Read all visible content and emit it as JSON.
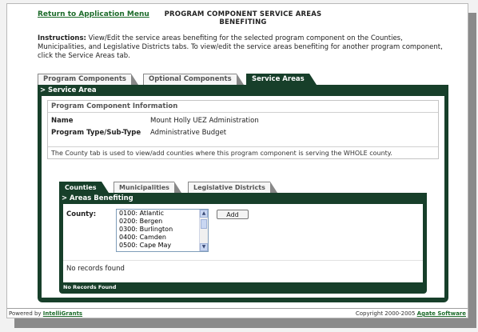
{
  "header": {
    "menu_link": "Return to Application Menu",
    "title_line1": "PROGRAM COMPONENT SERVICE AREAS",
    "title_line2": "BENEFITING"
  },
  "instructions": {
    "label": "Instructions:",
    "text": " View/Edit the service areas benefiting for the selected program component on the Counties, Municipalities, and Legislative Districts tabs. To view/edit the service areas benefiting for another program component, click the Service Areas tab."
  },
  "main_tabs": [
    {
      "label": "Program Components",
      "active": false
    },
    {
      "label": "Optional Components",
      "active": false
    },
    {
      "label": "Service Areas",
      "active": true
    }
  ],
  "service_panel": {
    "title": "Service Area",
    "info": {
      "title": "Program Component Information",
      "name_label": "Name",
      "name_value": "Mount Holly UEZ Administration",
      "type_label": "Program Type/Sub-Type",
      "type_value": "Administrative Budget",
      "note": "The County tab is used to view/add counties where this program component is serving the WHOLE county."
    }
  },
  "sub_tabs": [
    {
      "label": "Counties",
      "active": true
    },
    {
      "label": "Municipalities",
      "active": false
    },
    {
      "label": "Legislative Districts",
      "active": false
    }
  ],
  "areas_panel": {
    "title": "Areas Benefiting",
    "county_label": "County:",
    "county_options": [
      "0100: Atlantic",
      "0200: Bergen",
      "0300: Burlington",
      "0400: Camden",
      "0500: Cape May"
    ],
    "add_button": "Add",
    "empty_text": "No records found",
    "footer_status": "No Records Found"
  },
  "footer": {
    "powered_prefix": "Powered by ",
    "powered_link": "IntelliGrants",
    "copyright_prefix": "Copyright 2000-2005 ",
    "copyright_link": "Agate Software"
  },
  "colors": {
    "panel_green": "#173f2a",
    "link_green": "#1c6b2a"
  }
}
